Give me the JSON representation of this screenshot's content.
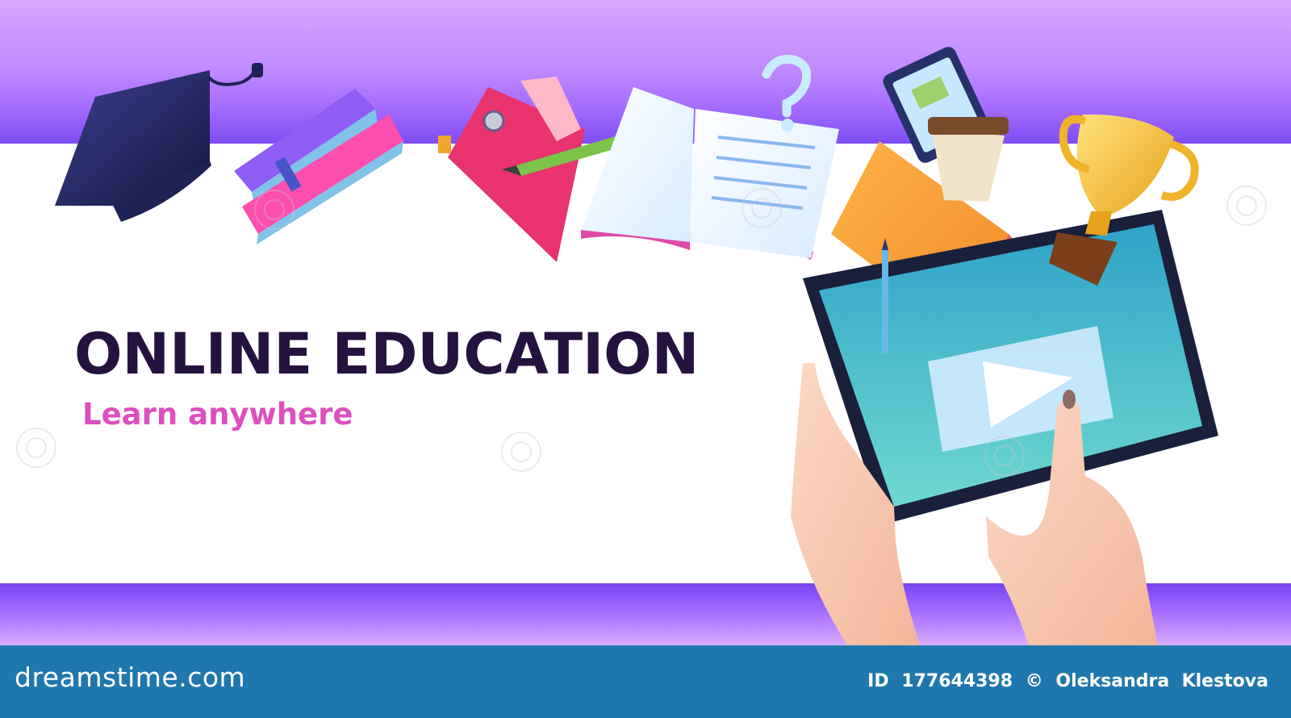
{
  "banner": {
    "title": "ONLINE EDUCATION",
    "subtitle": "Learn anywhere",
    "colors": {
      "band_purple": "#a66cff",
      "title": "#24123f",
      "subtitle": "#dd4fbf",
      "footer": "#1f78ad"
    },
    "icons": [
      "graduation-cap-icon",
      "book-stack-icon",
      "notebook-icon",
      "pencil-icon",
      "open-book-icon",
      "question-mark-icon",
      "phone-icon",
      "coffee-cup-icon",
      "trophy-icon",
      "tablet-icon",
      "play-icon",
      "hands-icon"
    ]
  },
  "footer": {
    "logo_text": "dreamstime.com",
    "id_label": "ID",
    "id_number": "177644398",
    "copyright_symbol": "©",
    "author": "Oleksandra  Klestova"
  }
}
